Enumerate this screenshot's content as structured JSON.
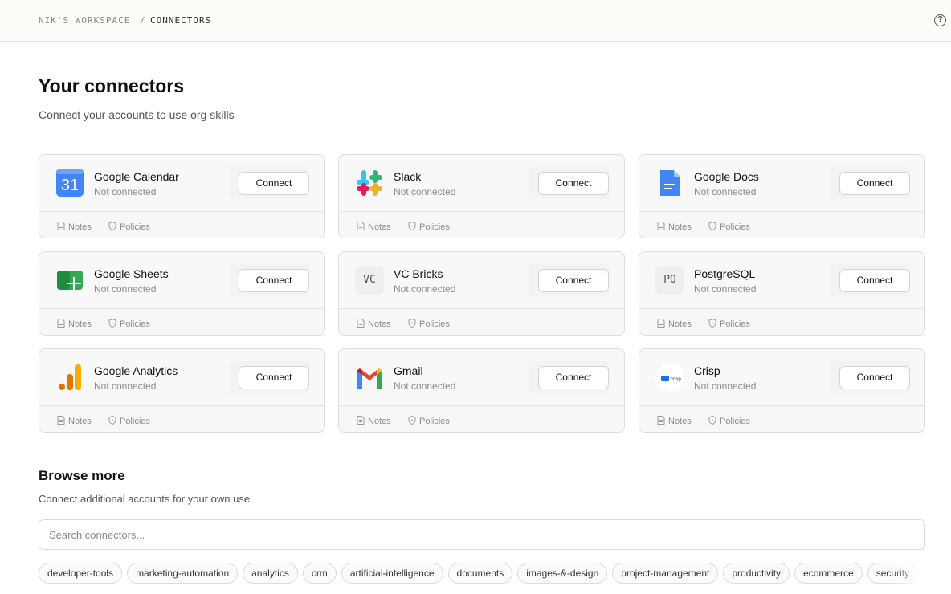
{
  "breadcrumb": {
    "workspace": "NIK'S WORKSPACE",
    "separator": "/",
    "current": "CONNECTORS"
  },
  "help_icon": "question-circle-icon",
  "your_connectors": {
    "title": "Your connectors",
    "subtitle": "Connect your accounts to use org skills"
  },
  "connectors": [
    {
      "name": "Google Calendar",
      "status": "Not connected",
      "button": "Connect",
      "notes": "Notes",
      "policies": "Policies",
      "icon": "google-calendar-icon",
      "icon_text": "31"
    },
    {
      "name": "Slack",
      "status": "Not connected",
      "button": "Connect",
      "notes": "Notes",
      "policies": "Policies",
      "icon": "slack-icon"
    },
    {
      "name": "Google Docs",
      "status": "Not connected",
      "button": "Connect",
      "notes": "Notes",
      "policies": "Policies",
      "icon": "google-docs-icon"
    },
    {
      "name": "Google Sheets",
      "status": "Not connected",
      "button": "Connect",
      "notes": "Notes",
      "policies": "Policies",
      "icon": "google-sheets-icon"
    },
    {
      "name": "VC Bricks",
      "status": "Not connected",
      "button": "Connect",
      "notes": "Notes",
      "policies": "Policies",
      "icon": "vc-bricks-icon",
      "icon_text": "VC"
    },
    {
      "name": "PostgreSQL",
      "status": "Not connected",
      "button": "Connect",
      "notes": "Notes",
      "policies": "Policies",
      "icon": "postgresql-icon",
      "icon_text": "PO"
    },
    {
      "name": "Google Analytics",
      "status": "Not connected",
      "button": "Connect",
      "notes": "Notes",
      "policies": "Policies",
      "icon": "google-analytics-icon"
    },
    {
      "name": "Gmail",
      "status": "Not connected",
      "button": "Connect",
      "notes": "Notes",
      "policies": "Policies",
      "icon": "gmail-icon"
    },
    {
      "name": "Crisp",
      "status": "Not connected",
      "button": "Connect",
      "notes": "Notes",
      "policies": "Policies",
      "icon": "crisp-icon",
      "icon_text": "crisp"
    }
  ],
  "browse_more": {
    "title": "Browse more",
    "subtitle": "Connect additional accounts for your own use",
    "search_placeholder": "Search connectors...",
    "tags": [
      "developer-tools",
      "marketing-automation",
      "analytics",
      "crm",
      "artificial-intelligence",
      "documents",
      "images-&-design",
      "project-management",
      "productivity",
      "ecommerce",
      "security"
    ]
  },
  "colors": {
    "topbar_bg": "#fcfbf7",
    "card_bg": "#f8f8f8",
    "border": "#dcdcdc",
    "muted_text": "#8a8a8a",
    "google_blue": "#4285f4",
    "google_red": "#ea4335",
    "google_yellow": "#fbbc04",
    "google_green": "#34a853",
    "analytics_orange": "#f9ab00",
    "crisp_blue": "#1972f5"
  }
}
